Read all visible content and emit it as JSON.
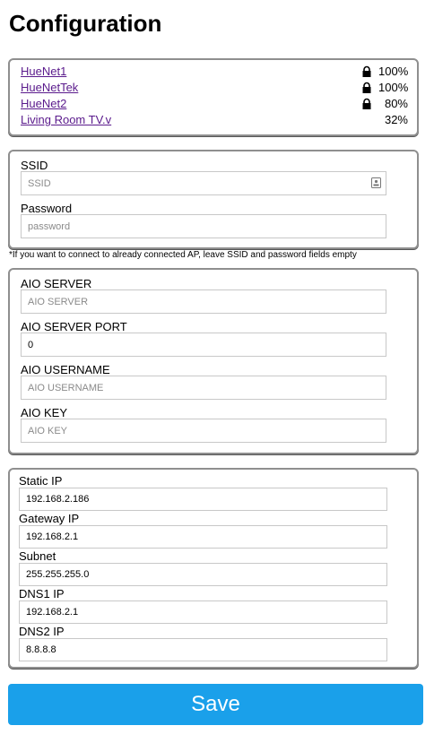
{
  "page": {
    "title": "Configuration"
  },
  "networks": [
    {
      "ssid": "HueNet1",
      "locked": true,
      "signal": "100%"
    },
    {
      "ssid": "HueNetTek",
      "locked": true,
      "signal": "100%"
    },
    {
      "ssid": "HueNet2",
      "locked": true,
      "signal": "80%"
    },
    {
      "ssid": "Living Room TV.v",
      "locked": false,
      "signal": "32%"
    }
  ],
  "wifi": {
    "ssid_label": "SSID",
    "ssid_placeholder": "SSID",
    "password_label": "Password",
    "password_placeholder": "password",
    "note": "*If you want to connect to already connected AP, leave SSID and password fields empty"
  },
  "aio": {
    "server_label": "AIO SERVER",
    "server_placeholder": "AIO SERVER",
    "port_label": "AIO SERVER PORT",
    "port_value": "0",
    "username_label": "AIO USERNAME",
    "username_placeholder": "AIO USERNAME",
    "key_label": "AIO KEY",
    "key_placeholder": "AIO KEY"
  },
  "network_config": {
    "static_ip_label": "Static IP",
    "static_ip_value": "192.168.2.186",
    "gateway_label": "Gateway IP",
    "gateway_value": "192.168.2.1",
    "subnet_label": "Subnet",
    "subnet_value": "255.255.255.0",
    "dns1_label": "DNS1 IP",
    "dns1_value": "192.168.2.1",
    "dns2_label": "DNS2 IP",
    "dns2_value": "8.8.8.8"
  },
  "actions": {
    "save_label": "Save"
  },
  "colors": {
    "save_button": "#1aa0ea",
    "link": "#5a1a8c"
  }
}
